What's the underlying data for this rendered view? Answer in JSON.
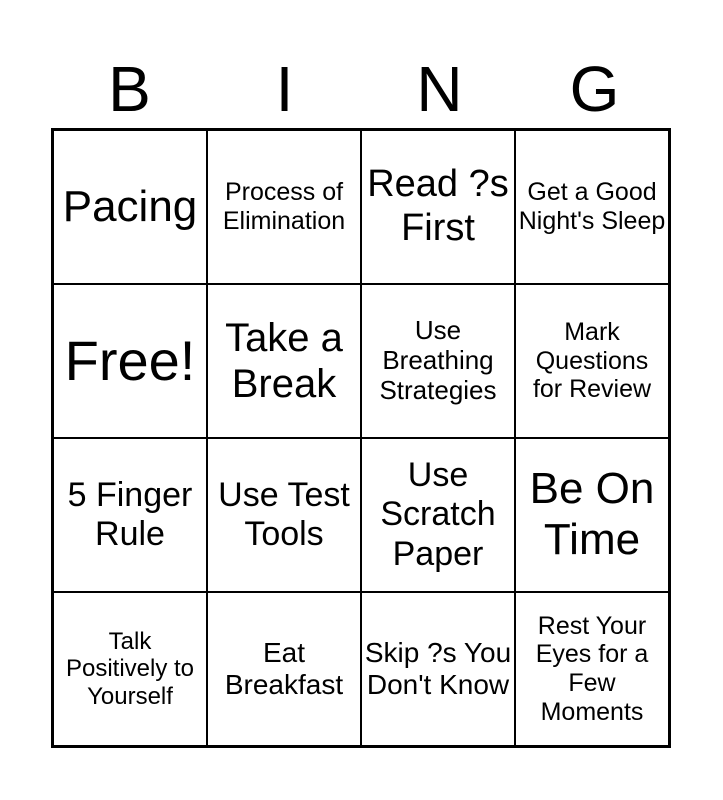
{
  "header": [
    "B",
    "I",
    "N",
    "G"
  ],
  "cells": [
    {
      "t": "Pacing",
      "s": 44
    },
    {
      "t": "Process of Elimination",
      "s": 25
    },
    {
      "t": "Read ?s First",
      "s": 38
    },
    {
      "t": "Get a Good Night's Sleep",
      "s": 25
    },
    {
      "t": "Free!",
      "s": 56
    },
    {
      "t": "Take a Break",
      "s": 40
    },
    {
      "t": "Use Breathing Strategies",
      "s": 26
    },
    {
      "t": "Mark Questions for Review",
      "s": 25
    },
    {
      "t": "5 Finger Rule",
      "s": 34
    },
    {
      "t": "Use Test Tools",
      "s": 34
    },
    {
      "t": "Use Scratch Paper",
      "s": 34
    },
    {
      "t": "Be On Time",
      "s": 44
    },
    {
      "t": "Talk Positively to Yourself",
      "s": 24
    },
    {
      "t": "Eat Breakfast",
      "s": 28
    },
    {
      "t": "Skip ?s You Don't Know",
      "s": 28
    },
    {
      "t": "Rest Your Eyes for a Few Moments",
      "s": 25
    }
  ]
}
